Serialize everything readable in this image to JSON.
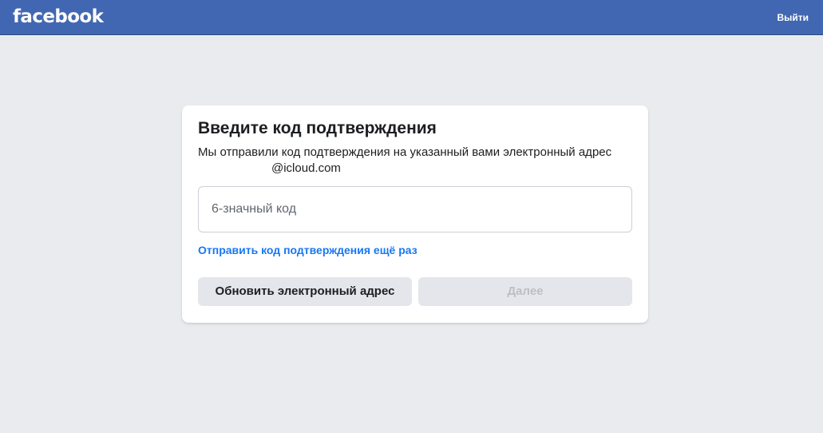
{
  "header": {
    "logo_text": "facebook",
    "logout_label": "Выйти",
    "bar_color": "#4267b2"
  },
  "card": {
    "title": "Введите код подтверждения",
    "description_prefix": "Мы отправили код подтверждения на указанный вами электронный адрес",
    "email_visible_suffix": "@icloud.com",
    "code_input": {
      "value": "",
      "placeholder": "6-значный код"
    },
    "resend_link": "Отправить код подтверждения ещё раз",
    "update_email_button": "Обновить электронный адрес",
    "next_button": "Далее",
    "next_button_disabled": true,
    "link_color": "#1877f2"
  }
}
